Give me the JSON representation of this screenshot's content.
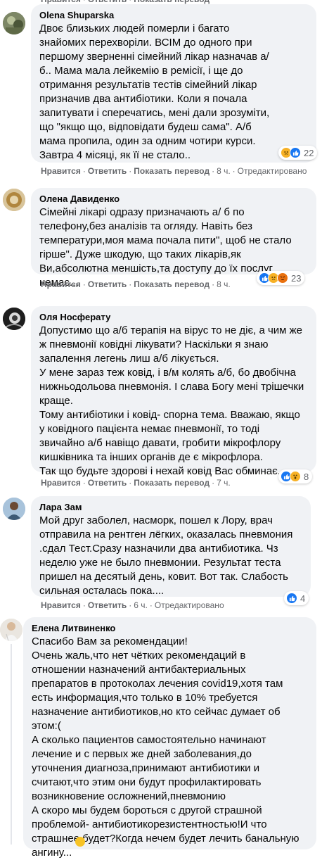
{
  "actions": {
    "like": "Нравится",
    "reply": "Ответить",
    "translate": "Показать перевод",
    "edited": "Отредактировано"
  },
  "comments": [
    {
      "author": "Olena Shuparska",
      "text": "Двоє близьких людей померли і багато\nзнайомих перехворіли. ВСІМ до одного при\nпершому зверненні сімейний лікар назначав а/\nб.. Мама мала лейкемію в ремісії, і ще до\nотримання результатів тестів сімейний лікар\nпризначив два антибіотики. Коли я почала\nзапитувати і сперечатись, мені дали зрозуміти,\nщо \"якщо що, відповідати будеш сама\". А/б\nмама пропила, один за одним чотири курси.\nЗавтра 4 місяці, як її не стало..",
      "time": "8 ч.",
      "reaction_count": "22",
      "reactions": [
        "sad",
        "like"
      ]
    },
    {
      "author": "Олена Давиденко",
      "text": "Сімейні лікарі одразу призначають а/ б по\nтелефону,без аналізів та огляду. Навіть без\nтемператури,моя мама почала пити\", щоб не стало\nгірше\". Дуже шкодую, що таких лікарів,як\nВи,абсолютна меншість,та доступу до їх послуг немає...",
      "time": "8 ч.",
      "reaction_count": "23",
      "reactions": [
        "like",
        "sad",
        "angry"
      ]
    },
    {
      "author": "Оля Носферату",
      "text": "Допустимо що а/б терапія на вірус то не діє, а чим же\nж пневмонії ковідні лікувати? Наскільки я знаю\nзапалення легень лиш а/б лікується.\nУ мене зараз теж ковід, і в/м колять а/б, бо двобічна\nнижньодольова пневмонія. І слава Богу мені трішечки\nкраще.\nТому антибіотики і ковід- спорна тема. Вважаю, якщо\nу ковідного пацієнта немає пневмонії, то тоді\nзвичайно а/б навіщо давати, гробити мікрофлору\nкишківника та інших органів де є мікрофлора.\nТак що будьте здорові і нехай ковід Вас обминає.",
      "time": "7 ч.",
      "reaction_count": "8",
      "reactions": [
        "like",
        "wow"
      ]
    },
    {
      "author": "Лара Зам",
      "text": "Мой друг заболел, насморк, пошел к Лору, врач\nотправила на рентген лёгких, оказалась пневмония\n.сдал Тест.Сразу назначили два антибиотика. Чз\nнеделю уже не было пневмонии. Результат теста\nпришел на десятый день, ковит. Вот так. Слабость\nсильная осталась пока....",
      "time": "6 ч.",
      "reaction_count": "4",
      "reactions": [
        "like"
      ]
    },
    {
      "author": "Елена Литвиненко",
      "text": "Спасибо Вам за рекомендации!\nОчень жаль,что нет чётких рекомендаций в\nотношении назначений антибактериальных\nпрепаратов в протоколах лечения covid19,хотя там\nесть информация,что только в 10% требуется\nназначение антибиотиков,но кто сейчас думает об\nэтом:(\nА сколько пациентов самостоятельно начинают\nлечение и с первых же дней заболевания,до\nуточнения диагноза,принимают антибиотики и\nсчитают,что этим они будут профилактировать\nвозникновение осложнений,пневмонию\nА скоро мы будем бороться с другой страшной\nпроблемой- антибиотикорезистентностью!И что\nстрашнее будет?Когда нечем будет лечить банальную\nангину..."
    }
  ],
  "colors": {
    "bubble": "#f0f2f5",
    "meta": "#65676b",
    "like": "#1877f2",
    "sad": "#f7b125",
    "angry": "#e9710f"
  }
}
